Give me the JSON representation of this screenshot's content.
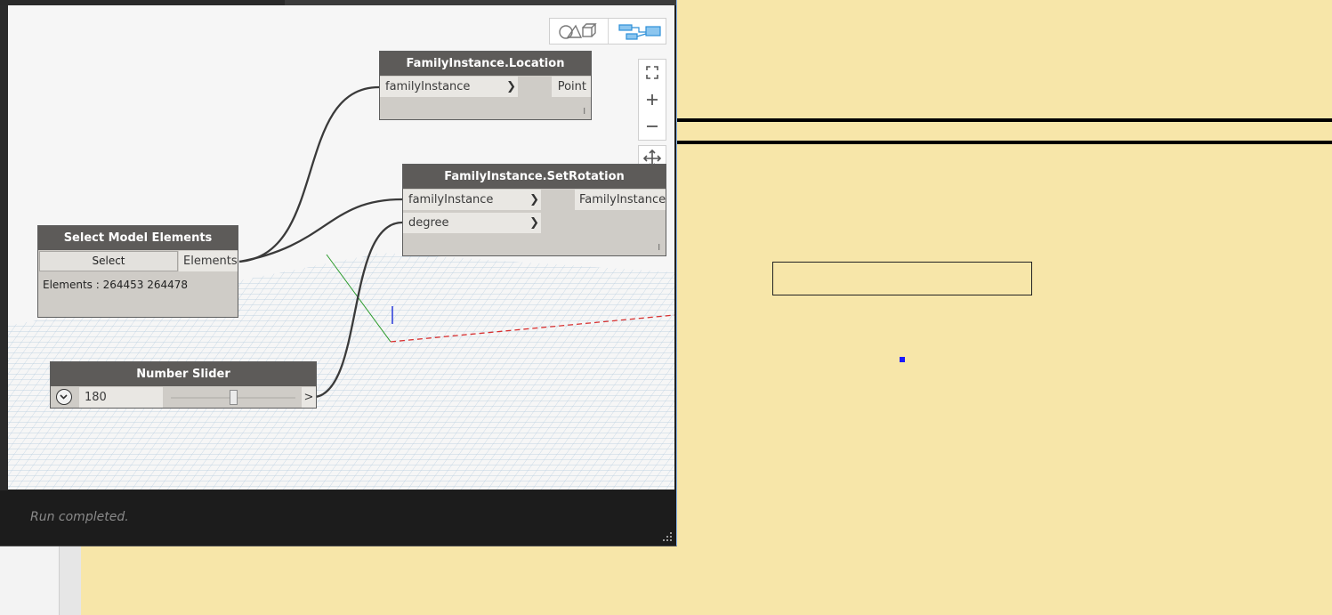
{
  "status": {
    "text": "Run completed."
  },
  "nodes": {
    "location": {
      "title": "FamilyInstance.Location",
      "inputs": [
        "familyInstance"
      ],
      "output": "Point",
      "lacing": "l"
    },
    "set_rotation": {
      "title": "FamilyInstance.SetRotation",
      "inputs": [
        "familyInstance",
        "degree"
      ],
      "output": "FamilyInstance",
      "lacing": "l"
    },
    "select_model": {
      "title": "Select Model Elements",
      "button": "Select",
      "output": "Elements",
      "preview": "Elements : 264453 264478"
    },
    "slider": {
      "title": "Number Slider",
      "value": "180",
      "output": ">",
      "fraction": 0.5
    }
  },
  "icons": {
    "expand": "chevron-down-icon",
    "geometry_view": "geometry-view-icon",
    "graph_view": "graph-view-icon",
    "fit": "fit-to-screen-icon",
    "zoom_in": "plus-icon",
    "zoom_out": "minus-icon",
    "pan": "pan-icon"
  },
  "colors": {
    "node_header": "#5d5b59",
    "node_body": "#cfccc7",
    "wire": "#3a3a3a",
    "revit_background": "#f7e6a9",
    "accent": "#2d8fd8"
  }
}
